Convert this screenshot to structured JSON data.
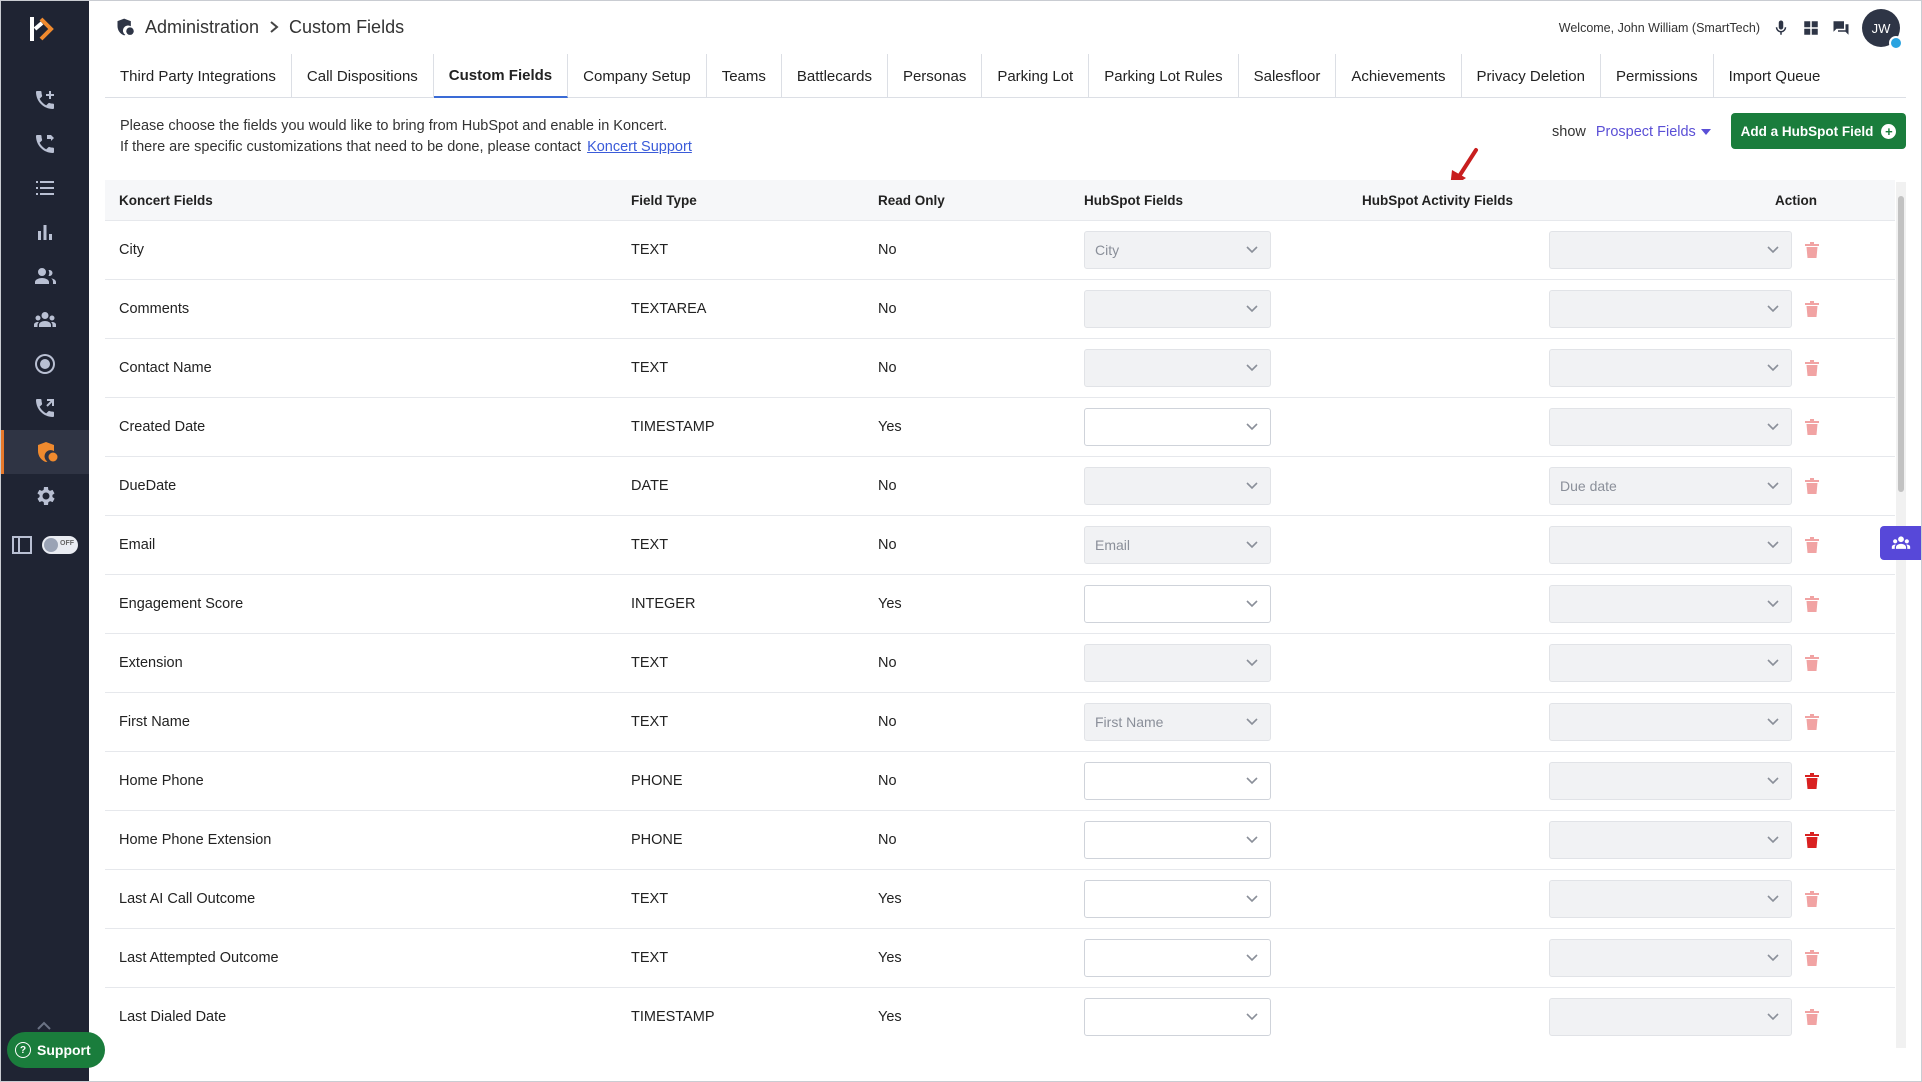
{
  "header": {
    "breadcrumb_root": "Administration",
    "breadcrumb_current": "Custom Fields",
    "welcome_text": "Welcome, John William",
    "org": "(SmartTech)",
    "avatar_initials": "JW"
  },
  "sidebar": {
    "toggle_label": "OFF",
    "support_label": "Support"
  },
  "tabs": [
    "Third Party Integrations",
    "Call Dispositions",
    "Custom Fields",
    "Company Setup",
    "Teams",
    "Battlecards",
    "Personas",
    "Parking Lot",
    "Parking Lot Rules",
    "Salesfloor",
    "Achievements",
    "Privacy Deletion",
    "Permissions",
    "Import Queue"
  ],
  "info": {
    "line1": "Please choose the fields you would like to bring from HubSpot and enable in Koncert.",
    "line2": "If there are specific customizations that need to be done, please contact",
    "link": "Koncert Support"
  },
  "toolbar": {
    "show_label": "show",
    "show_value": "Prospect Fields",
    "add_button": "Add a HubSpot Field"
  },
  "table": {
    "headers": [
      "Koncert Fields",
      "Field Type",
      "Read Only",
      "HubSpot Fields",
      "HubSpot Activity Fields",
      "Action"
    ],
    "rows": [
      {
        "name": "City",
        "type": "TEXT",
        "read_only": "No",
        "hubspot": "City",
        "hubspot_disabled": true,
        "activity": "",
        "trash_active": false
      },
      {
        "name": "Comments",
        "type": "TEXTAREA",
        "read_only": "No",
        "hubspot": "",
        "hubspot_disabled": true,
        "activity": "",
        "trash_active": false
      },
      {
        "name": "Contact Name",
        "type": "TEXT",
        "read_only": "No",
        "hubspot": "",
        "hubspot_disabled": true,
        "activity": "",
        "trash_active": false
      },
      {
        "name": "Created Date",
        "type": "TIMESTAMP",
        "read_only": "Yes",
        "hubspot": "",
        "hubspot_disabled": false,
        "activity": "",
        "trash_active": false
      },
      {
        "name": "DueDate",
        "type": "DATE",
        "read_only": "No",
        "hubspot": "",
        "hubspot_disabled": true,
        "activity": "Due date",
        "trash_active": false
      },
      {
        "name": "Email",
        "type": "TEXT",
        "read_only": "No",
        "hubspot": "Email",
        "hubspot_disabled": true,
        "activity": "",
        "trash_active": false
      },
      {
        "name": "Engagement Score",
        "type": "INTEGER",
        "read_only": "Yes",
        "hubspot": "",
        "hubspot_disabled": false,
        "activity": "",
        "trash_active": false
      },
      {
        "name": "Extension",
        "type": "TEXT",
        "read_only": "No",
        "hubspot": "",
        "hubspot_disabled": true,
        "activity": "",
        "trash_active": false
      },
      {
        "name": "First Name",
        "type": "TEXT",
        "read_only": "No",
        "hubspot": "First Name",
        "hubspot_disabled": true,
        "activity": "",
        "trash_active": false
      },
      {
        "name": "Home Phone",
        "type": "PHONE",
        "read_only": "No",
        "hubspot": "",
        "hubspot_disabled": false,
        "activity": "",
        "trash_active": true
      },
      {
        "name": "Home Phone Extension",
        "type": "PHONE",
        "read_only": "No",
        "hubspot": "",
        "hubspot_disabled": false,
        "activity": "",
        "trash_active": true
      },
      {
        "name": "Last AI Call Outcome",
        "type": "TEXT",
        "read_only": "Yes",
        "hubspot": "",
        "hubspot_disabled": false,
        "activity": "",
        "trash_active": false
      },
      {
        "name": "Last Attempted Outcome",
        "type": "TEXT",
        "read_only": "Yes",
        "hubspot": "",
        "hubspot_disabled": false,
        "activity": "",
        "trash_active": false
      },
      {
        "name": "Last Dialed Date",
        "type": "TIMESTAMP",
        "read_only": "Yes",
        "hubspot": "",
        "hubspot_disabled": false,
        "activity": "",
        "trash_active": false
      }
    ]
  },
  "colors": {
    "sidebar_bg": "#1f2433",
    "accent_orange": "#f08a2e",
    "primary_green": "#1a7d3c",
    "link_purple": "#5a4fd6",
    "trash_active": "#d92121",
    "trash_faded": "#f1a3a3"
  },
  "icons": {
    "sidebar": [
      "dialer-plus-icon",
      "dialer-transfer-icon",
      "list-icon",
      "bar-chart-icon",
      "users-icon",
      "team-icon",
      "target-icon",
      "phone-forward-icon",
      "admin-shield-icon",
      "gear-icon"
    ],
    "header": [
      "admin-shield-icon",
      "chevron-right-icon",
      "microphone-icon",
      "apps-grid-icon",
      "chat-icon"
    ]
  }
}
